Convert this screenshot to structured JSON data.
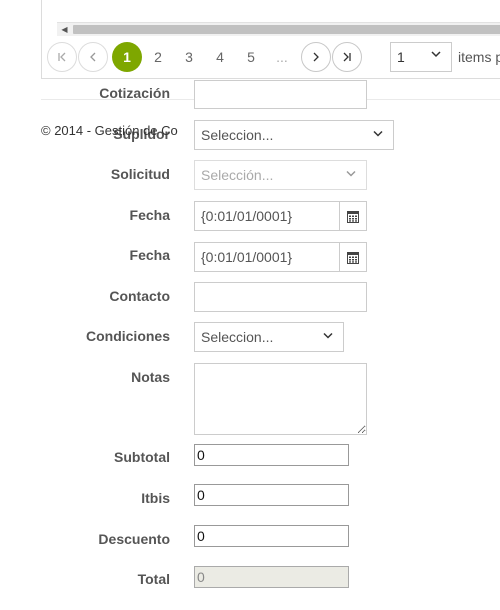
{
  "pager": {
    "pages": [
      "1",
      "2",
      "3",
      "4",
      "5"
    ],
    "ellipsis": "...",
    "page_size": "1",
    "items_label": "items p"
  },
  "footer": {
    "text": "© 2014 - Gestión de Co"
  },
  "form": {
    "cotizacion_label": "Cotización",
    "suplidor_label": "Suplidor",
    "suplidor_value": "Seleccion...",
    "solicitud_label": "Solicitud",
    "solicitud_value": "Selección...",
    "fecha1_label": "Fecha",
    "fecha1_value": "{0:01/01/0001}",
    "fecha2_label": "Fecha",
    "fecha2_value": "{0:01/01/0001}",
    "contacto_label": "Contacto",
    "condiciones_label": "Condiciones",
    "condiciones_value": "Seleccion...",
    "notas_label": "Notas",
    "subtotal_label": "Subtotal",
    "subtotal_value": "0",
    "itbis_label": "Itbis",
    "itbis_value": "0",
    "descuento_label": "Descuento",
    "descuento_value": "0",
    "total_label": "Total",
    "total_value": "0"
  },
  "colors": {
    "active_page": "#7ea700"
  },
  "icons": {
    "first": "first-page-icon",
    "prev": "prev-page-icon",
    "next": "next-page-icon",
    "last": "last-page-icon",
    "calendar": "calendar-icon",
    "chevron": "chevron-down-icon"
  }
}
